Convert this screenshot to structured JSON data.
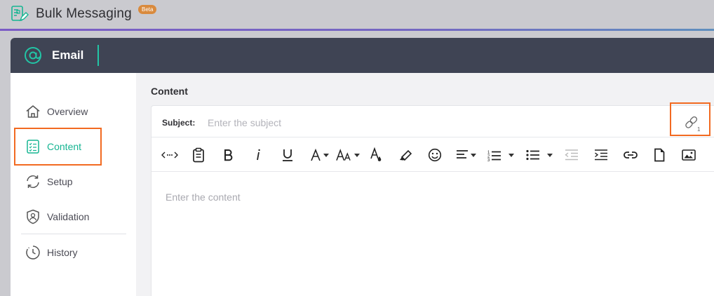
{
  "app": {
    "title": "Bulk Messaging",
    "badge": "Beta"
  },
  "panel": {
    "title": "Email"
  },
  "sidebar": {
    "items": [
      {
        "label": "Overview",
        "icon": "home-icon"
      },
      {
        "label": "Content",
        "icon": "checklist-icon",
        "active": true
      },
      {
        "label": "Setup",
        "icon": "sync-icon"
      },
      {
        "label": "Validation",
        "icon": "shield-user-icon"
      },
      {
        "label": "History",
        "icon": "clock-history-icon"
      }
    ]
  },
  "main": {
    "section_title": "Content",
    "subject": {
      "label": "Subject:",
      "placeholder": "Enter the subject",
      "value": ""
    },
    "link_count": "1",
    "content_placeholder": "Enter the content"
  },
  "colors": {
    "accent": "#16b592",
    "highlight": "#f26a21",
    "header": "#3f4454",
    "badge": "#d98a3d"
  }
}
